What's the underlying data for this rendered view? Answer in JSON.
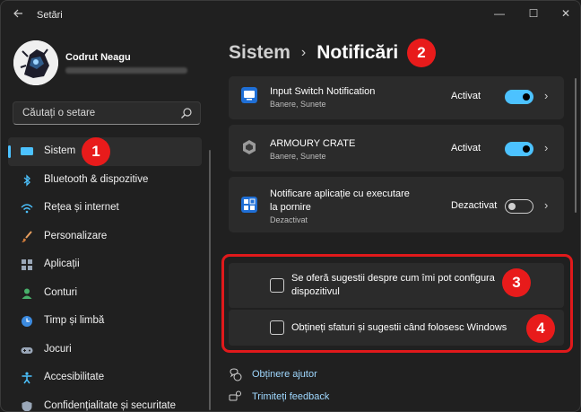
{
  "window": {
    "title": "Setări",
    "back_icon": "arrow-left-icon",
    "minimize_glyph": "—",
    "maximize_glyph": "☐",
    "close_glyph": "✕"
  },
  "profile": {
    "name": "Codrut Neagu"
  },
  "search": {
    "placeholder": "Căutați o setare"
  },
  "sidebar": {
    "items": [
      {
        "label": "Sistem",
        "icon": "display-icon",
        "active": true
      },
      {
        "label": "Bluetooth & dispozitive",
        "icon": "bluetooth-icon"
      },
      {
        "label": "Rețea și internet",
        "icon": "wifi-icon"
      },
      {
        "label": "Personalizare",
        "icon": "brush-icon"
      },
      {
        "label": "Aplicații",
        "icon": "apps-icon"
      },
      {
        "label": "Conturi",
        "icon": "account-icon"
      },
      {
        "label": "Timp și limbă",
        "icon": "globe-clock-icon"
      },
      {
        "label": "Jocuri",
        "icon": "gamepad-icon"
      },
      {
        "label": "Accesibilitate",
        "icon": "accessibility-icon"
      },
      {
        "label": "Confidențialitate și securitate",
        "icon": "shield-icon"
      }
    ]
  },
  "header": {
    "parent": "Sistem",
    "separator": "›",
    "current": "Notificări"
  },
  "notifications": [
    {
      "title": "Input Switch Notification",
      "subtitle": "Banere, Sunete",
      "state": "Activat",
      "on": true
    },
    {
      "title": "ARMOURY CRATE",
      "subtitle": "Banere, Sunete",
      "state": "Activat",
      "on": true
    },
    {
      "title_line1": "Notificare aplicație cu executare",
      "title_line2": "la pornire",
      "subtitle": "Dezactivat",
      "state": "Dezactivat",
      "on": false
    }
  ],
  "checkboxes": [
    {
      "line1": "Se oferă sugestii despre cum îmi pot configura",
      "line2": "dispozitivul",
      "checked": false
    },
    {
      "line1": "Obțineți sfaturi și sugestii când folosesc Windows",
      "checked": false
    }
  ],
  "links": {
    "help": "Obținere ajutor",
    "feedback": "Trimiteți feedback"
  },
  "annotations": {
    "badge1": "1",
    "badge2": "2",
    "badge3": "3",
    "badge4": "4"
  },
  "colors": {
    "accent": "#4cc2ff",
    "annotation_red": "#e0191b"
  }
}
